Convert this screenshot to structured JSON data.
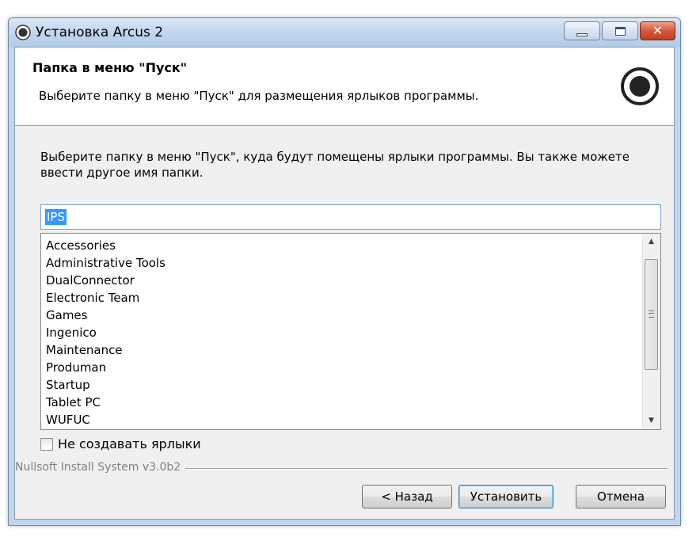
{
  "window": {
    "title": "Установка Arcus 2",
    "controls": {
      "minimize": "minimize",
      "maximize": "maximize",
      "close": "✕"
    }
  },
  "header": {
    "title": "Папка в меню \"Пуск\"",
    "subtitle": "Выберите папку в меню \"Пуск\" для размещения ярлыков программы."
  },
  "main": {
    "intro": "Выберите папку в меню \"Пуск\", куда будут помещены ярлыки программы. Вы также можете ввести другое имя папки.",
    "folder_input": {
      "value": "IPS"
    },
    "folder_list": [
      "Accessories",
      "Administrative Tools",
      "DualConnector",
      "Electronic Team",
      "Games",
      "Ingenico",
      "Maintenance",
      "Produman",
      "Startup",
      "Tablet PC",
      "WUFUC"
    ],
    "no_shortcuts_checkbox": {
      "label": "Не создавать ярлыки",
      "checked": false
    }
  },
  "footer": {
    "branding": "Nullsoft Install System v3.0b2",
    "buttons": {
      "back": "< Назад",
      "install": "Установить",
      "cancel": "Отмена"
    }
  },
  "colors": {
    "selection": "#3399ff",
    "title_bar": "#c2d6ed",
    "close_button": "#c43c20"
  }
}
